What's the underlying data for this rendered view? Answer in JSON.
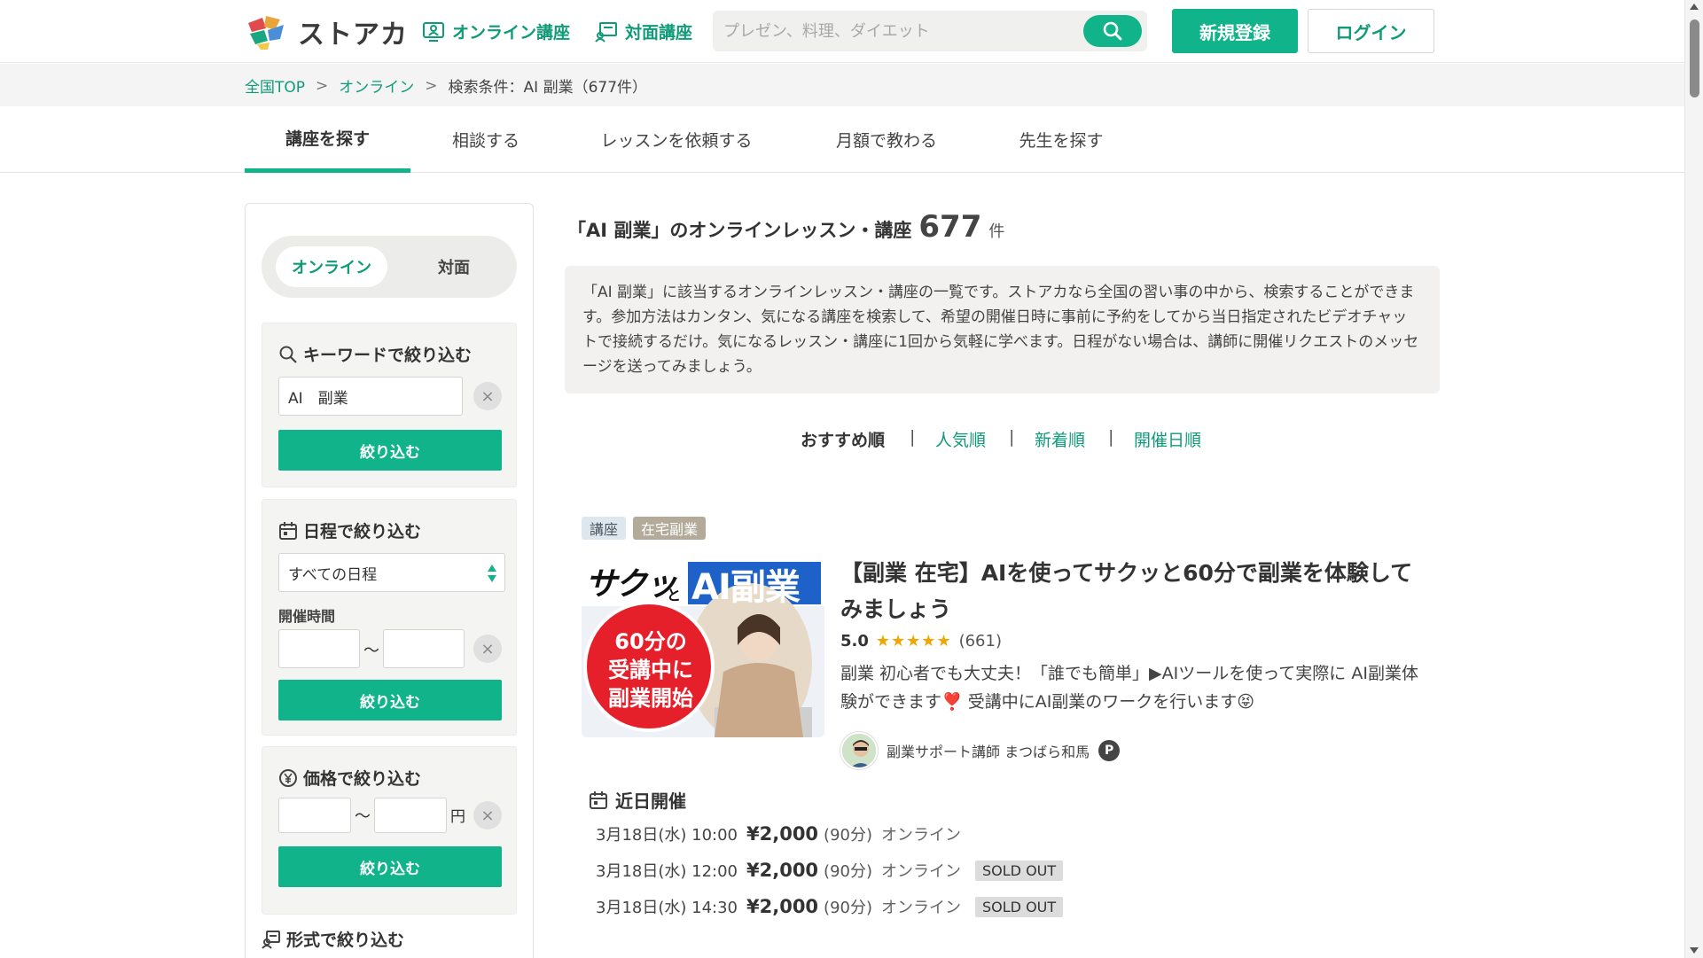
{
  "header": {
    "logo_text": "ストアカ",
    "nav_online": "オンライン講座",
    "nav_offline": "対面講座",
    "search_placeholder": "プレゼン、料理、ダイエット",
    "register": "新規登録",
    "login": "ログイン"
  },
  "breadcrumb": {
    "top": "全国TOP",
    "online": "オンライン",
    "sep": ">",
    "current": "検索条件：AI 副業（677件）"
  },
  "tabs": [
    "講座を探す",
    "相談する",
    "レッスンを依頼する",
    "月額で教わる",
    "先生を探す"
  ],
  "sidebar": {
    "mode_online": "オンライン",
    "mode_offline": "対面",
    "keyword_title": "キーワードで絞り込む",
    "keyword_value": "AI　副業",
    "filter_button": "絞り込む",
    "date_title": "日程で絞り込む",
    "date_select": "すべての日程",
    "time_label": "開催時間",
    "tilde": "〜",
    "clear": "×",
    "price_title": "価格で絞り込む",
    "yen_unit": "円",
    "format_title": "形式で絞り込む"
  },
  "main": {
    "title": "「AI 副業」のオンラインレッスン・講座",
    "count": "677",
    "unit": "件",
    "description": "「AI 副業」に該当するオンラインレッスン・講座の一覧です。ストアカなら全国の習い事の中から、検索することができます。参加方法はカンタン、気になる講座を検索して、希望の開催日時に事前に予約をしてから当日指定されたビデオチャットで接続するだけ。気になるレッスン・講座に1回から気軽に学べます。日程がない場合は、講師に開催リクエストのメッセージを送ってみましょう。",
    "sort": {
      "current": "おすすめ順",
      "popular": "人気順",
      "newest": "新着順",
      "date": "開催日順",
      "bar": "|"
    }
  },
  "course": {
    "tag_kind": "講座",
    "tag_category": "在宅副業",
    "thumb_line1": "サクッ",
    "thumb_to": "と",
    "thumb_line2": "AI副業",
    "thumb_circle_1": "60分の",
    "thumb_circle_2": "受講中に",
    "thumb_circle_3": "副業開始",
    "title": "【副業 在宅】AIを使ってサクッと60分で副業を体験してみましょう",
    "score": "5.0",
    "stars": "★★★★★",
    "review_count": "(661)",
    "description": "副業 初心者でも大丈夫！「誰でも簡単」▶AIツールを使って実際に AI副業体験ができます❣️ 受講中にAI副業のワークを行います😝",
    "teacher": "副業サポート講師 まつばら和馬",
    "badge": "P",
    "upcoming_label": "近日開催",
    "sessions": [
      {
        "datetime": "3月18日(水) 10:00",
        "price": "¥2,000",
        "duration": "(90分)",
        "mode": "オンライン",
        "status": ""
      },
      {
        "datetime": "3月18日(水) 12:00",
        "price": "¥2,000",
        "duration": "(90分)",
        "mode": "オンライン",
        "status": "SOLD OUT"
      },
      {
        "datetime": "3月18日(水) 14:30",
        "price": "¥2,000",
        "duration": "(90分)",
        "mode": "オンライン",
        "status": "SOLD OUT"
      }
    ]
  },
  "colors": {
    "accent": "#11b38a",
    "accent_text": "#109b78"
  }
}
